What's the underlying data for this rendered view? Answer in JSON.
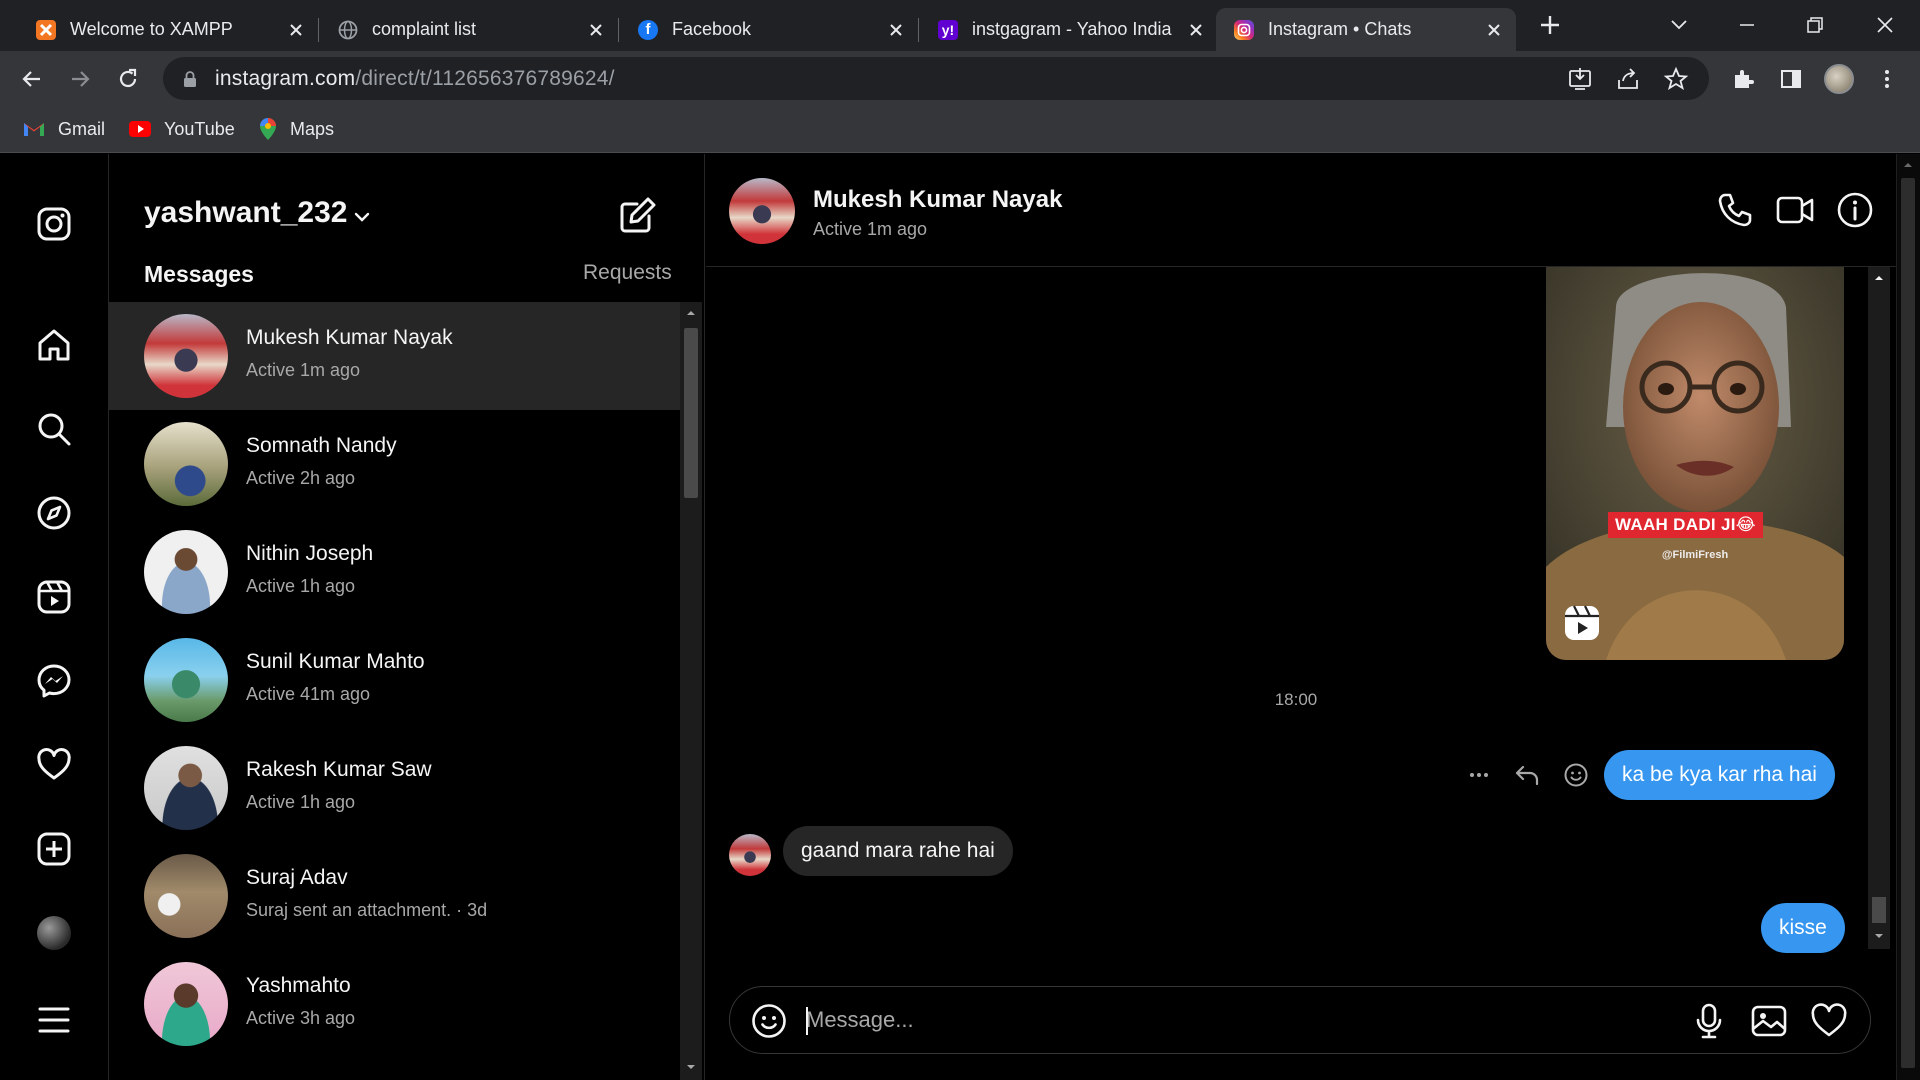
{
  "browser": {
    "tabs": [
      {
        "title": "Welcome to XAMPP",
        "icon": "xampp-icon",
        "active": false
      },
      {
        "title": "complaint list",
        "icon": "globe-icon",
        "active": false
      },
      {
        "title": "Facebook",
        "icon": "facebook-icon",
        "active": false
      },
      {
        "title": "instgagram - Yahoo India",
        "icon": "yahoo-icon",
        "active": false
      },
      {
        "title": "Instagram • Chats",
        "icon": "instagram-icon",
        "active": true
      }
    ],
    "url_host": "instagram.com",
    "url_path": "/direct/t/112656376789624/",
    "bookmarks": [
      {
        "label": "Gmail",
        "icon": "gmail-icon"
      },
      {
        "label": "YouTube",
        "icon": "youtube-icon"
      },
      {
        "label": "Maps",
        "icon": "maps-icon"
      }
    ]
  },
  "inbox": {
    "username": "yashwant_232",
    "messages_label": "Messages",
    "requests_label": "Requests",
    "threads": [
      {
        "name": "Mukesh Kumar Nayak",
        "subtitle": "Active 1m ago",
        "selected": true
      },
      {
        "name": "Somnath Nandy",
        "subtitle": "Active 2h ago"
      },
      {
        "name": "Nithin Joseph",
        "subtitle": "Active 1h ago"
      },
      {
        "name": "Sunil Kumar Mahto",
        "subtitle": "Active 41m ago"
      },
      {
        "name": "Rakesh Kumar Saw",
        "subtitle": "Active 1h ago"
      },
      {
        "name": "Suraj Adav",
        "subtitle": "Suraj sent an attachment. · 3d"
      },
      {
        "name": "Yashmahto",
        "subtitle": "Active 3h ago"
      }
    ]
  },
  "chat": {
    "name": "Mukesh Kumar Nayak",
    "status": "Active 1m ago",
    "reel": {
      "caption": "WAAH DADI JI😂",
      "credit": "@FilmiFresh"
    },
    "timestamp": "18:00",
    "messages": [
      {
        "text": "ka be kya kar rha hai",
        "from": "me"
      },
      {
        "text": "gaand mara rahe hai",
        "from": "them"
      },
      {
        "text": "kisse",
        "from": "me"
      }
    ],
    "composer_placeholder": "Message..."
  },
  "colors": {
    "accent_blue": "#3797f0",
    "incoming_bubble": "#262626",
    "background": "#000000",
    "chrome_tabstrip": "#202124",
    "chrome_toolbar": "#35363a"
  }
}
